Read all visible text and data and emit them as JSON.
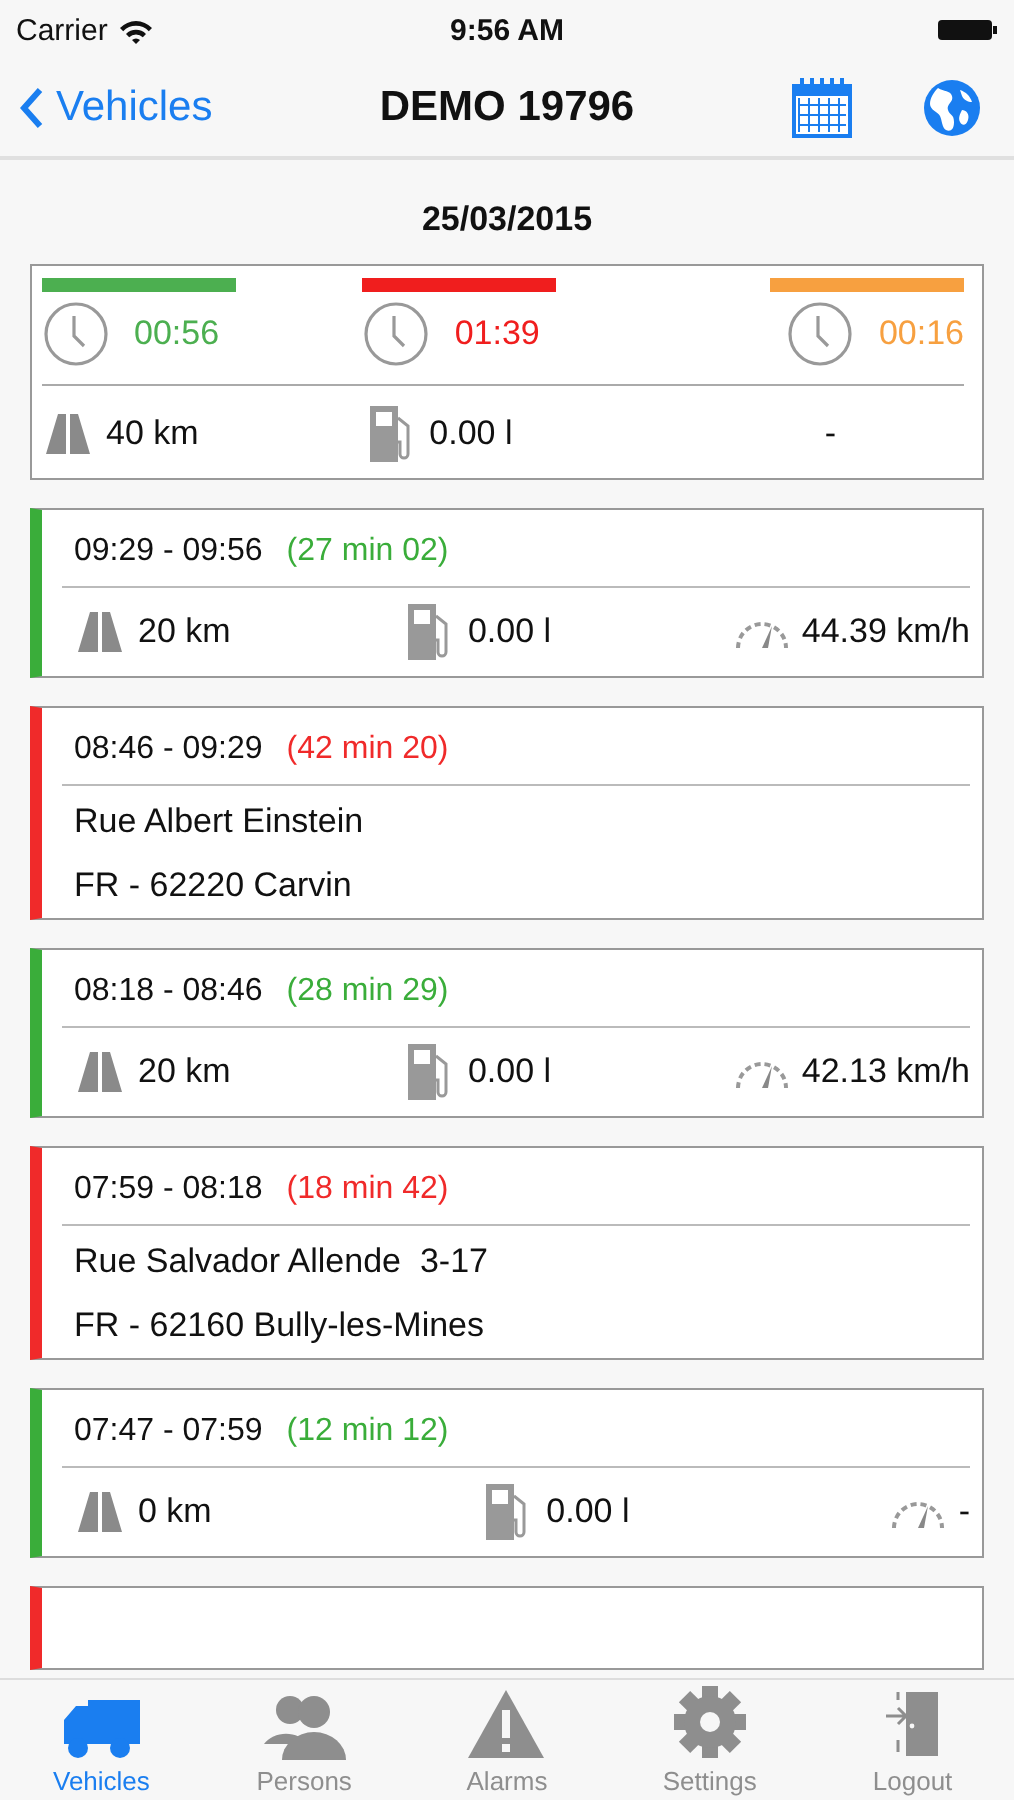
{
  "status_bar": {
    "carrier": "Carrier",
    "time": "9:56 AM"
  },
  "nav": {
    "back": "Vehicles",
    "title": "DEMO 19796"
  },
  "date": "25/03/2015",
  "summary": {
    "periods": [
      {
        "time": "00:56",
        "color": "#4caf50"
      },
      {
        "time": "01:39",
        "color": "#f01e1e"
      },
      {
        "time": "00:16",
        "color": "#f7a040"
      }
    ],
    "distance": "40 km",
    "fuel": "0.00 l",
    "speed": "-"
  },
  "trips": [
    {
      "kind": "drive",
      "color": "#3aad3a",
      "time": "09:29 - 09:56",
      "duration": "(27 min 02)",
      "distance": "20 km",
      "fuel": "0.00 l",
      "speed": "44.39 km/h"
    },
    {
      "kind": "stop",
      "color": "#f02a2a",
      "time": "08:46 - 09:29",
      "duration": "(42 min 20)",
      "street": "Rue Albert Einstein",
      "city": "FR - 62220 Carvin"
    },
    {
      "kind": "drive",
      "color": "#3aad3a",
      "time": "08:18 - 08:46",
      "duration": "(28 min 29)",
      "distance": "20 km",
      "fuel": "0.00 l",
      "speed": "42.13 km/h"
    },
    {
      "kind": "stop",
      "color": "#f02a2a",
      "time": "07:59 - 08:18",
      "duration": "(18 min 42)",
      "street": "Rue Salvador Allende  3-17",
      "city": "FR - 62160 Bully-les-Mines"
    },
    {
      "kind": "drive",
      "color": "#3aad3a",
      "time": "07:47 - 07:59",
      "duration": "(12 min 12)",
      "distance": "0 km",
      "fuel": "0.00 l",
      "speed": "-"
    },
    {
      "kind": "stop",
      "color": "#f02a2a"
    }
  ],
  "tabs": [
    {
      "label": "Vehicles",
      "kind": "truck",
      "selected": true
    },
    {
      "label": "Persons",
      "kind": "persons",
      "selected": false
    },
    {
      "label": "Alarms",
      "kind": "alarm",
      "selected": false
    },
    {
      "label": "Settings",
      "kind": "gear",
      "selected": false
    },
    {
      "label": "Logout",
      "kind": "door",
      "selected": false
    }
  ]
}
